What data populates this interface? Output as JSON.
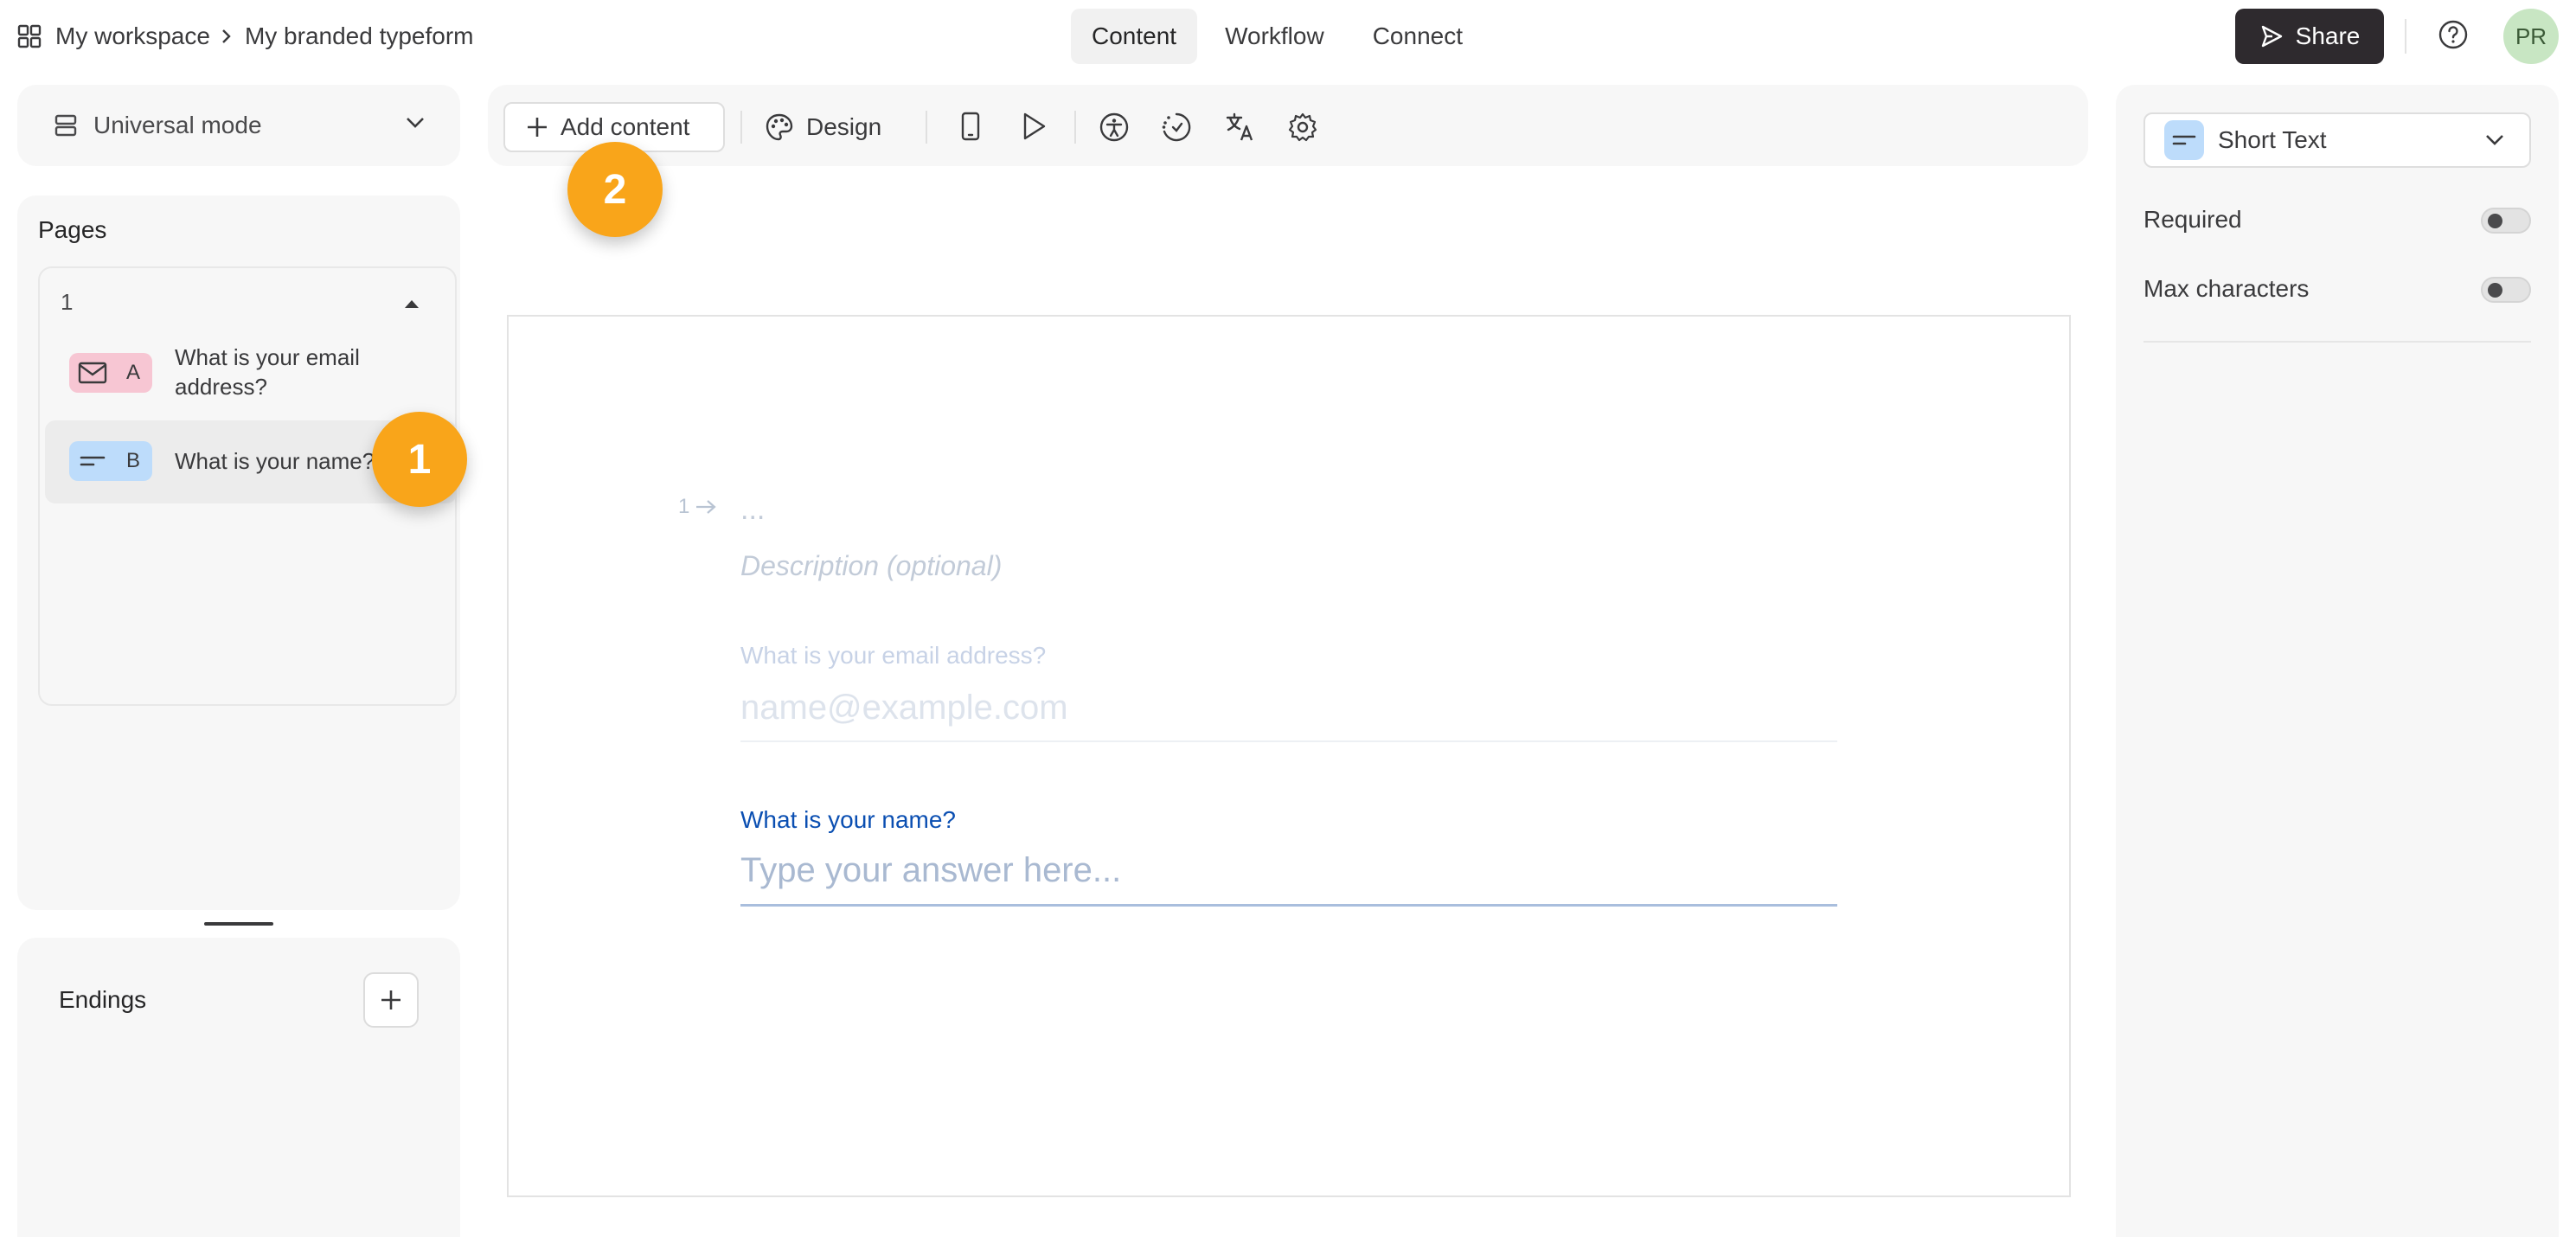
{
  "breadcrumb": {
    "workspace": "My workspace",
    "form": "My branded typeform"
  },
  "nav_tabs": [
    {
      "label": "Content",
      "active": true
    },
    {
      "label": "Workflow",
      "active": false
    },
    {
      "label": "Connect",
      "active": false
    }
  ],
  "header": {
    "share_label": "Share",
    "avatar_initials": "PR"
  },
  "sidebar": {
    "mode_label": "Universal mode",
    "pages_title": "Pages",
    "page_number": "1",
    "questions": [
      {
        "letter": "A",
        "text": "What is your email address?",
        "icon": "mail-icon",
        "color": "#f7c6d3"
      },
      {
        "letter": "B",
        "text": "What is your name?",
        "icon": "short-text-icon",
        "color": "#bddcfb",
        "selected": true
      }
    ],
    "endings_title": "Endings"
  },
  "toolbar": {
    "add_content_label": "Add content",
    "design_label": "Design"
  },
  "steps": {
    "step1": "1",
    "step2": "2"
  },
  "canvas": {
    "question_number": "1",
    "title_placeholder": "...",
    "description_placeholder": "Description (optional)",
    "field1_label": "What is your email address?",
    "field1_placeholder": "name@example.com",
    "field2_label": "What is your name?",
    "field2_placeholder": "Type your answer here..."
  },
  "settings": {
    "question_type": "Short Text",
    "required_label": "Required",
    "required_on": false,
    "max_chars_label": "Max characters",
    "max_chars_on": false
  },
  "colors": {
    "accent_step": "#f9a51a",
    "share_bg": "#2e2a2e",
    "field_label_active": "#0b4fb2"
  }
}
